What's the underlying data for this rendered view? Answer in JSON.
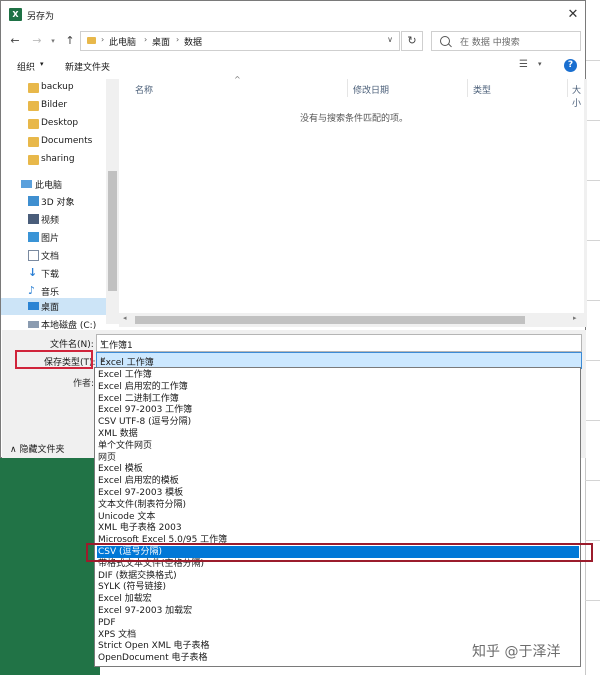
{
  "window": {
    "title": "另存为",
    "app_icon": "X"
  },
  "address": {
    "crumbs": [
      "此电脑",
      "桌面",
      "数据"
    ],
    "search_placeholder": "在 数据 中搜索"
  },
  "toolbar": {
    "organize": "组织",
    "new_folder": "新建文件夹",
    "help": "?"
  },
  "nav": {
    "items": [
      {
        "label": "backup"
      },
      {
        "label": "Bilder"
      },
      {
        "label": "Desktop"
      },
      {
        "label": "Documents"
      },
      {
        "label": "sharing"
      },
      {
        "label": "此电脑"
      },
      {
        "label": "3D 对象"
      },
      {
        "label": "视频"
      },
      {
        "label": "图片"
      },
      {
        "label": "文档"
      },
      {
        "label": "下载"
      },
      {
        "label": "音乐"
      },
      {
        "label": "桌面"
      },
      {
        "label": "本地磁盘 (C:)"
      }
    ]
  },
  "columns": {
    "name": "名称",
    "date": "修改日期",
    "type": "类型",
    "size": "大小"
  },
  "empty_message": "没有与搜索条件匹配的项。",
  "form": {
    "filename_label": "文件名(N):",
    "filename_value": "工作簿1",
    "filetype_label": "保存类型(T):",
    "filetype_value": "Excel 工作簿",
    "author_label": "作者:",
    "hide_folders": "隐藏文件夹"
  },
  "dropdown": {
    "selected_index": 15,
    "options": [
      "Excel 工作簿",
      "Excel 启用宏的工作簿",
      "Excel 二进制工作簿",
      "Excel 97-2003 工作簿",
      "CSV UTF-8 (逗号分隔)",
      "XML 数据",
      "单个文件网页",
      "网页",
      "Excel 模板",
      "Excel 启用宏的模板",
      "Excel 97-2003 模板",
      "文本文件(制表符分隔)",
      "Unicode 文本",
      "XML 电子表格 2003",
      "Microsoft Excel 5.0/95 工作簿",
      "CSV (逗号分隔)",
      "带格式文本文件(空格分隔)",
      "DIF (数据交换格式)",
      "SYLK (符号链接)",
      "Excel 加载宏",
      "Excel 97-2003 加载宏",
      "PDF",
      "XPS 文档",
      "Strict Open XML 电子表格",
      "OpenDocument 电子表格"
    ]
  },
  "watermark": "知乎 @于泽洋",
  "colors": {
    "accent": "#0078d7",
    "highlight_red": "#d0243b",
    "excel_green": "#217346"
  }
}
